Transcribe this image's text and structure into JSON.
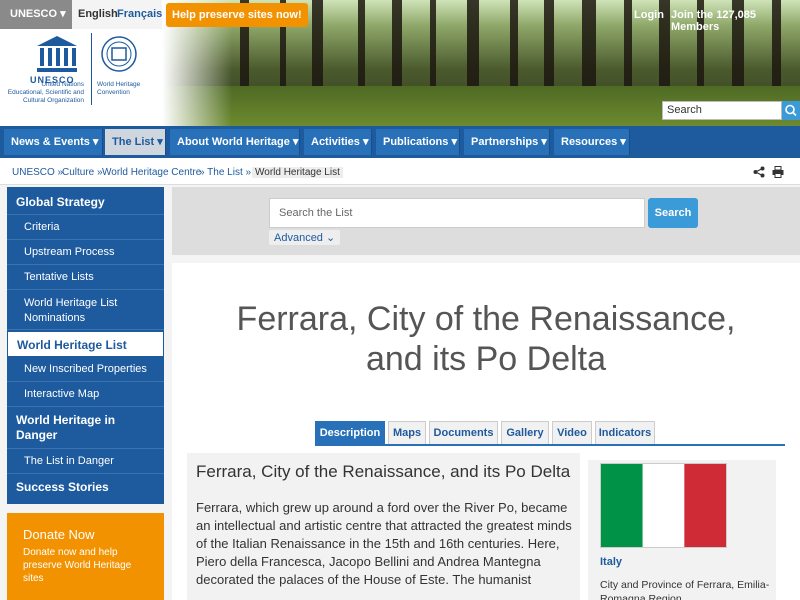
{
  "topbar": {
    "unesco_label": "UNESCO ▾",
    "lang_en": "English",
    "lang_fr": "Français",
    "help_label": "Help preserve sites now!",
    "login_label": "Login",
    "join_label": "Join the 127,085 Members"
  },
  "logo": {
    "unesco_word": "UNESCO",
    "un_text": "United Nations Educational, Scientific and Cultural Organization",
    "whc_text": "World Heritage Convention"
  },
  "header_search": {
    "placeholder": "Search"
  },
  "nav": {
    "items": [
      {
        "label": "News & Events ▾"
      },
      {
        "label": "The List ▾"
      },
      {
        "label": "About World Heritage ▾"
      },
      {
        "label": "Activities ▾"
      },
      {
        "label": "Publications ▾"
      },
      {
        "label": "Partnerships ▾"
      },
      {
        "label": "Resources ▾"
      }
    ]
  },
  "breadcrumb": {
    "items": [
      "UNESCO »",
      "Culture »",
      "World Heritage Centre",
      "» The List »"
    ],
    "current": "World Heritage List"
  },
  "sidebar": {
    "items": [
      {
        "label": "Global Strategy"
      },
      {
        "label": "Criteria"
      },
      {
        "label": "Upstream Process"
      },
      {
        "label": "Tentative Lists"
      },
      {
        "label": "World Heritage List Nominations"
      },
      {
        "label": "World Heritage List"
      },
      {
        "label": "New Inscribed Properties"
      },
      {
        "label": "Interactive Map"
      },
      {
        "label": "World Heritage in Danger"
      },
      {
        "label": "The List in Danger"
      },
      {
        "label": "Success Stories"
      }
    ]
  },
  "donate": {
    "title": "Donate Now",
    "text": "Donate now and help preserve World Heritage sites"
  },
  "list_search": {
    "placeholder": "Search the List",
    "button": "Search",
    "advanced": "Advanced ⌄"
  },
  "page": {
    "title_line1": "Ferrara, City of the Renaissance,",
    "title_line2": "and its Po Delta"
  },
  "tabs": [
    {
      "label": "Description"
    },
    {
      "label": "Maps"
    },
    {
      "label": "Documents"
    },
    {
      "label": "Gallery"
    },
    {
      "label": "Video"
    },
    {
      "label": "Indicators"
    }
  ],
  "description": {
    "title": "Ferrara, City of the Renaissance, and its Po Delta",
    "text": "Ferrara, which grew up around a ford over the River Po, became an intellectual and artistic centre that attracted the greatest minds of the Italian Renaissance in the 15th and 16th centuries. Here, Piero della Francesca, Jacopo Bellini and Andrea Mantegna decorated the palaces of the House of Este. The humanist"
  },
  "side_panel": {
    "country": "Italy",
    "location": "City and Province of Ferrara, Emilia-Romagna Region"
  },
  "colors": {
    "brand_blue": "#1d5a9e",
    "nav_item": "#2871b9",
    "orange": "#f39200",
    "flag_green": "#009246",
    "flag_white": "#ffffff",
    "flag_red": "#ce2b37"
  }
}
